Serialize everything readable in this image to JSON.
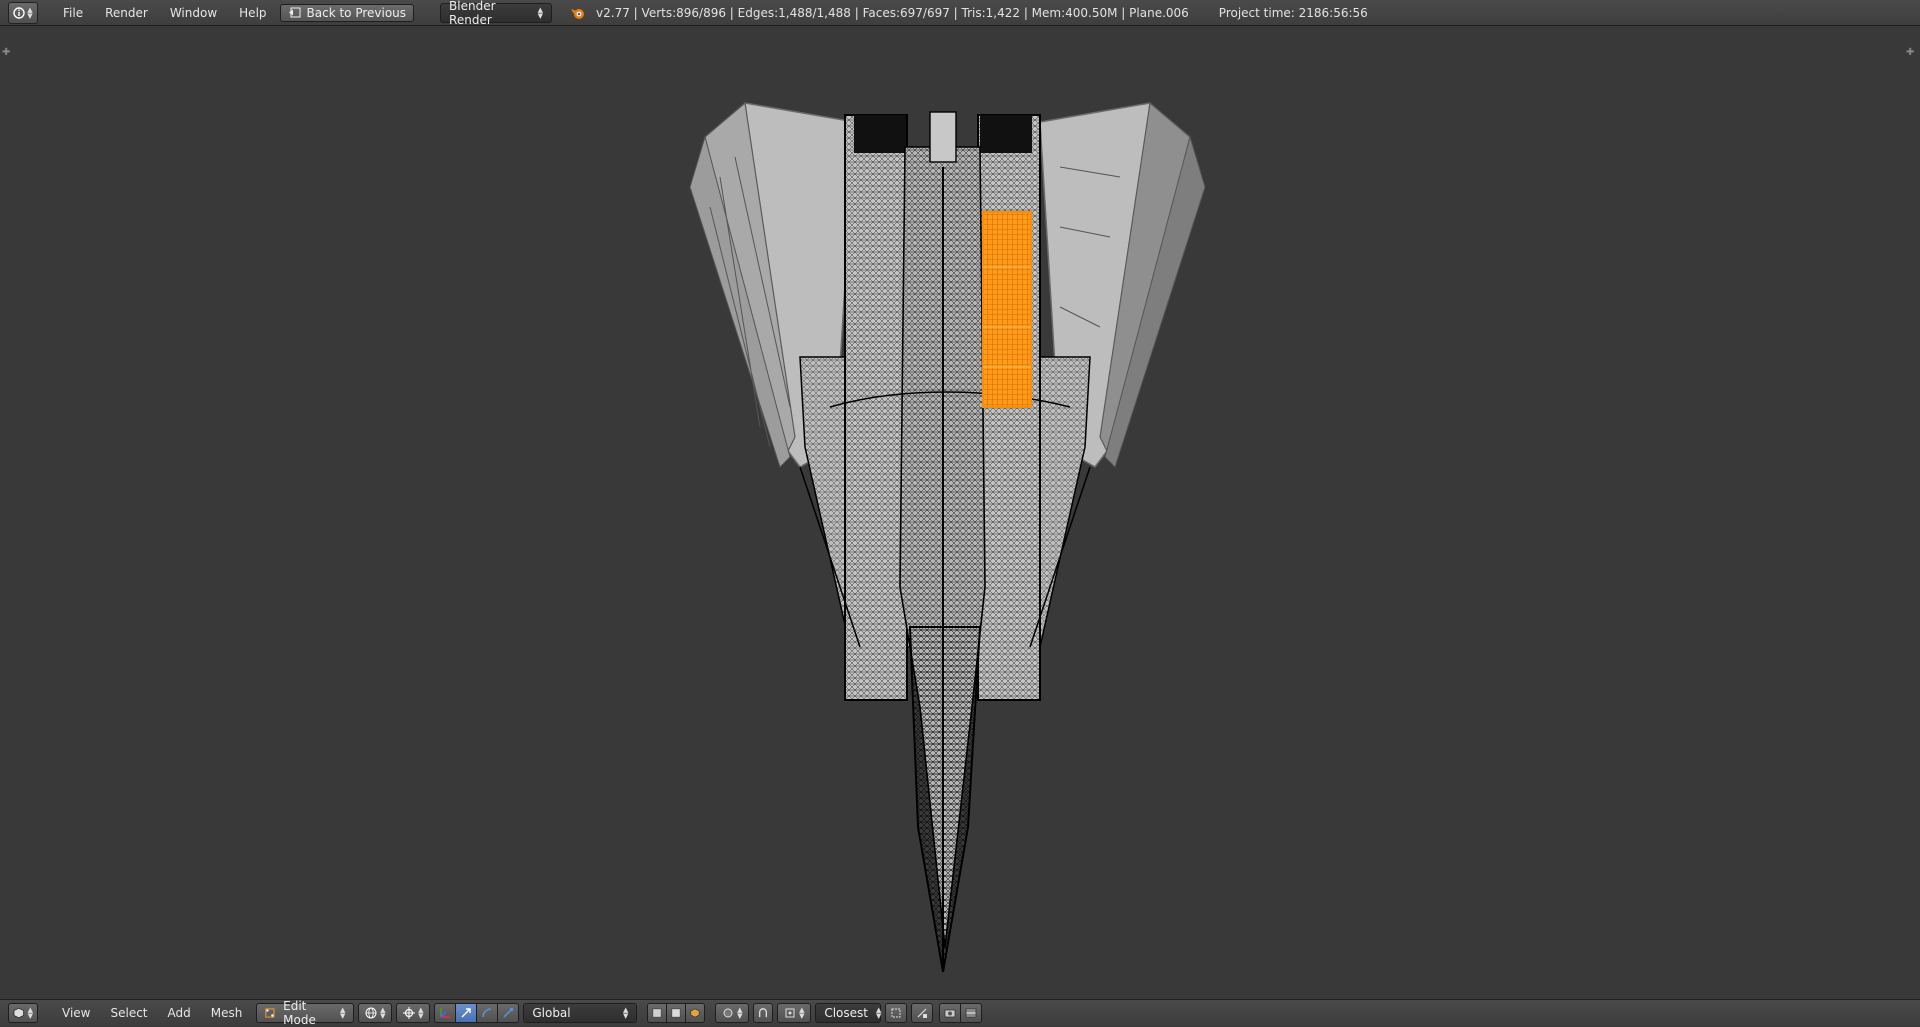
{
  "topbar": {
    "menu": [
      "File",
      "Render",
      "Window",
      "Help"
    ],
    "back_label": "Back to Previous",
    "engine": "Blender Render",
    "stats": "v2.77 | Verts:896/896 | Edges:1,488/1,488 | Faces:697/697 | Tris:1,422 | Mem:400.50M | Plane.006",
    "project_time": "Project time: 2186:56:56"
  },
  "bottombar": {
    "menu": [
      "View",
      "Select",
      "Add",
      "Mesh"
    ],
    "mode": "Edit Mode",
    "orientation": "Global",
    "snap_target": "Closest"
  },
  "colors": {
    "viewport_bg": "#393939",
    "selection": "#ff8c00",
    "mesh_fill": "#b4b4b4",
    "wire": "#000000"
  },
  "icons": [
    "info-icon",
    "back-icon",
    "blender-logo-icon",
    "cube-icon",
    "edit-mode-icon",
    "pivot-icon",
    "manipulator-icon",
    "vertex-select-icon",
    "edge-select-icon",
    "face-select-icon",
    "snap-icon",
    "render-icon"
  ]
}
